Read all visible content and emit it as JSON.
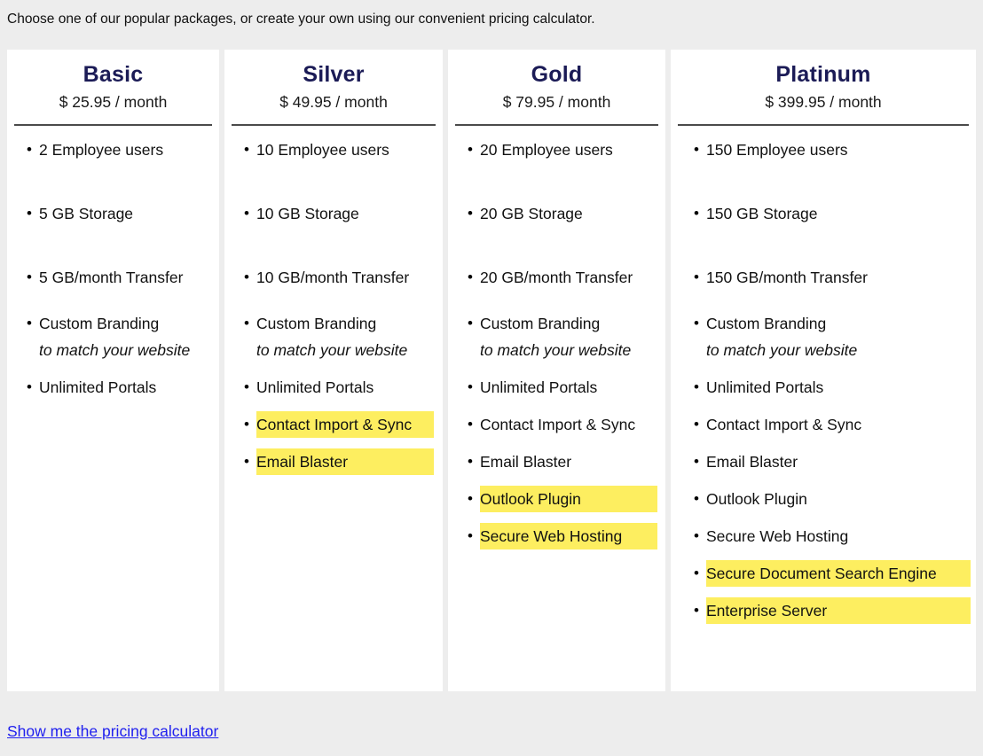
{
  "intro": "Choose one of our popular packages, or create your own using our convenient pricing calculator.",
  "bullet_glyph": "•",
  "colors": {
    "page_background": "#ededed",
    "card_background": "#ffffff",
    "plan_title": "#1b1b56",
    "highlight": "#fdee60",
    "link": "#2020ee",
    "rule": "#4a4a4a"
  },
  "plans": [
    {
      "name": "Basic",
      "price": "$ 25.95 / month",
      "features": [
        {
          "text": "2 Employee users",
          "highlight": false,
          "sub": "",
          "spacing": "lg"
        },
        {
          "text": "5 GB Storage",
          "highlight": false,
          "sub": "",
          "spacing": "lg"
        },
        {
          "text": "5 GB/month Transfer",
          "highlight": false,
          "sub": "",
          "spacing": "sm"
        },
        {
          "text": "Custom Branding",
          "highlight": false,
          "sub": "to match your website",
          "spacing": "xs"
        },
        {
          "text": "Unlimited Portals",
          "highlight": false,
          "sub": "",
          "spacing": "0"
        }
      ]
    },
    {
      "name": "Silver",
      "price": "$ 49.95 / month",
      "features": [
        {
          "text": "10 Employee users",
          "highlight": false,
          "sub": "",
          "spacing": "lg"
        },
        {
          "text": "10 GB Storage",
          "highlight": false,
          "sub": "",
          "spacing": "lg"
        },
        {
          "text": "10 GB/month Transfer",
          "highlight": false,
          "sub": "",
          "spacing": "sm"
        },
        {
          "text": "Custom Branding",
          "highlight": false,
          "sub": "to match your website",
          "spacing": "xs"
        },
        {
          "text": "Unlimited Portals",
          "highlight": false,
          "sub": "",
          "spacing": "xs"
        },
        {
          "text": "Contact Import & Sync",
          "highlight": true,
          "sub": "",
          "spacing": "xs"
        },
        {
          "text": "Email Blaster",
          "highlight": true,
          "sub": "",
          "spacing": "0"
        }
      ]
    },
    {
      "name": "Gold",
      "price": "$ 79.95 / month",
      "features": [
        {
          "text": "20 Employee users",
          "highlight": false,
          "sub": "",
          "spacing": "lg"
        },
        {
          "text": "20 GB Storage",
          "highlight": false,
          "sub": "",
          "spacing": "lg"
        },
        {
          "text": "20 GB/month Transfer",
          "highlight": false,
          "sub": "",
          "spacing": "sm"
        },
        {
          "text": "Custom Branding",
          "highlight": false,
          "sub": "to match your website",
          "spacing": "xs"
        },
        {
          "text": "Unlimited Portals",
          "highlight": false,
          "sub": "",
          "spacing": "xs"
        },
        {
          "text": "Contact Import & Sync",
          "highlight": false,
          "sub": "",
          "spacing": "xs"
        },
        {
          "text": "Email Blaster",
          "highlight": false,
          "sub": "",
          "spacing": "xs"
        },
        {
          "text": "Outlook Plugin",
          "highlight": true,
          "sub": "",
          "spacing": "xs"
        },
        {
          "text": "Secure Web Hosting",
          "highlight": true,
          "sub": "",
          "spacing": "0"
        }
      ]
    },
    {
      "name": "Platinum",
      "price": "$ 399.95 / month",
      "features": [
        {
          "text": "150 Employee users",
          "highlight": false,
          "sub": "",
          "spacing": "lg"
        },
        {
          "text": "150 GB Storage",
          "highlight": false,
          "sub": "",
          "spacing": "lg"
        },
        {
          "text": "150 GB/month Transfer",
          "highlight": false,
          "sub": "",
          "spacing": "sm"
        },
        {
          "text": "Custom Branding",
          "highlight": false,
          "sub": "to match your website",
          "spacing": "xs"
        },
        {
          "text": "Unlimited Portals",
          "highlight": false,
          "sub": "",
          "spacing": "xs"
        },
        {
          "text": "Contact Import & Sync",
          "highlight": false,
          "sub": "",
          "spacing": "xs"
        },
        {
          "text": "Email Blaster",
          "highlight": false,
          "sub": "",
          "spacing": "xs"
        },
        {
          "text": "Outlook Plugin",
          "highlight": false,
          "sub": "",
          "spacing": "xs"
        },
        {
          "text": "Secure Web Hosting",
          "highlight": false,
          "sub": "",
          "spacing": "xs"
        },
        {
          "text": "Secure Document Search Engine",
          "highlight": true,
          "sub": "",
          "spacing": "xs"
        },
        {
          "text": "Enterprise Server",
          "highlight": true,
          "sub": "",
          "spacing": "0"
        }
      ]
    }
  ],
  "calculator_link": "Show me the pricing calculator"
}
